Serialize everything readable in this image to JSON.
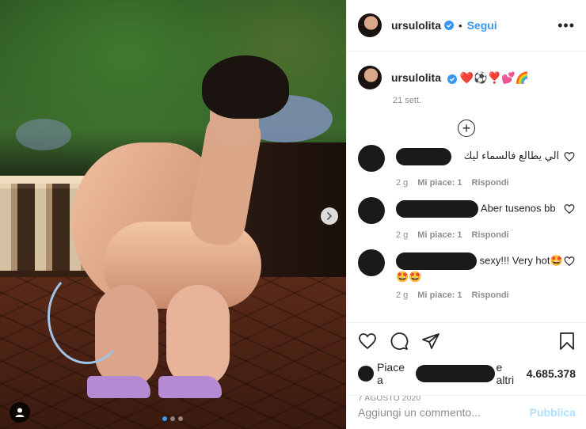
{
  "header": {
    "username": "ursulolita",
    "separator": "•",
    "follow_label": "Segui",
    "more_label": "•••"
  },
  "caption": {
    "username": "ursulolita",
    "text": "❤️⚽️❣️💕🌈",
    "date": "21 sett."
  },
  "comments": [
    {
      "text": "الي يطالع فالسماء ليك",
      "age": "2 g",
      "likes": "Mi piace: 1",
      "reply": "Rispondi"
    },
    {
      "text": "Aber tusenos bb",
      "age": "2 g",
      "likes": "Mi piace: 1",
      "reply": "Rispondi"
    },
    {
      "text": "sexy!!! Very hot🤩🤩🤩",
      "age": "2 g",
      "likes": "Mi piace: 1",
      "reply": "Rispondi"
    }
  ],
  "likes": {
    "prefix": "Piace a",
    "suffix": "e altri",
    "count": "4.685.378"
  },
  "post_date": "7 AGOSTO 2020",
  "add_comment": {
    "placeholder": "Aggiungi un commento...",
    "publish_label": "Pubblica"
  },
  "carousel": {
    "current": 1,
    "total": 3
  },
  "colors": {
    "accent": "#3897f0",
    "publish_disabled": "#b2dffc",
    "muted": "#8e8e8e"
  },
  "icons": [
    "verified-icon",
    "more-icon",
    "plus-circle-icon",
    "heart-icon",
    "comment-icon",
    "share-icon",
    "bookmark-icon",
    "chevron-right-icon",
    "user-tag-icon"
  ]
}
